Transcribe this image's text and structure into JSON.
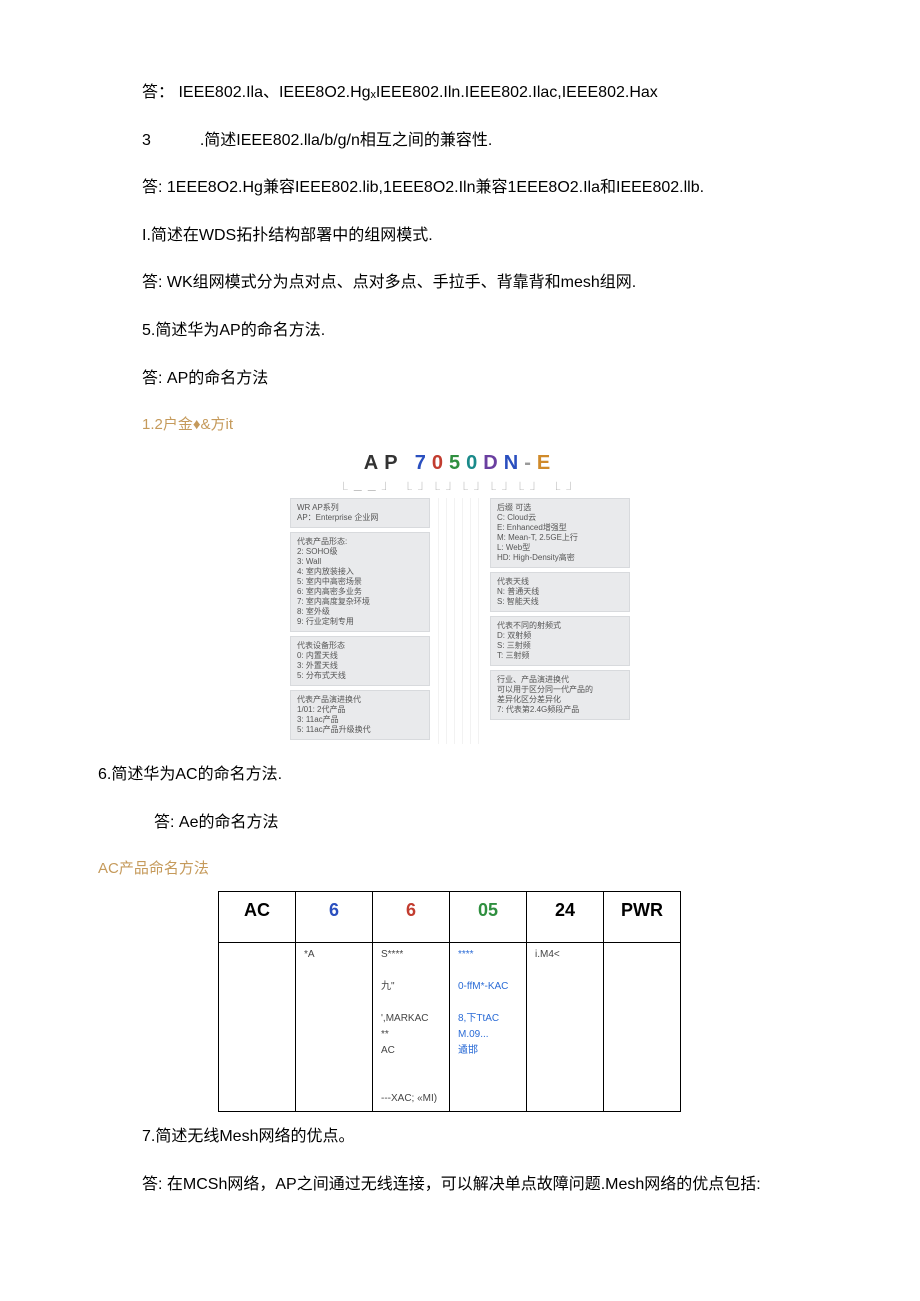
{
  "intro": {
    "answer_prefix": "答：",
    "standards": "IEEE802.Ila、IEEE8O2.HgₓIEEE802.Iln.IEEE802.Ilac,IEEE802.Hax"
  },
  "q3": {
    "number": "3",
    "text": ".简述IEEE802.lla/b/g/n相互之间的兼容性.",
    "answer": "答: 1EEE8O2.Hg兼容IEEE802.lib,1EEE8O2.Iln兼容1EEE8O2.Ila和IEEE802.llb."
  },
  "q4": {
    "text": "I.简述在WDS拓扑结构部署中的组网模式.",
    "answer": "答: WK组网模式分为点对点、点对多点、手拉手、背靠背和mesh组网."
  },
  "q5": {
    "text": "5.简述华为AP的命名方法.",
    "answer": "答: AP的命名方法",
    "sub_heading": "1.2户金♦&方it"
  },
  "ap_diagram": {
    "title_parts": [
      "A",
      "P",
      " ",
      "7",
      "0",
      "5",
      "0",
      "D",
      "N",
      "-",
      "E"
    ],
    "under": "⎿⎽⎽⏌ ⎿⏌⎿⏌⎿⏌⎿⏌⎿⏌  ⎿⏌",
    "left_boxes": [
      "WR AP系列\nAP：Enterprise 企业网",
      "代表产品形态:\n2: SOHO级\n3: Wall\n4: 室内放装接入\n5: 室内中高密场景\n6: 室内高密多业务\n7: 室内高度复杂环境\n8: 室外级\n9: 行业定制专用",
      "代表设备形态\n0: 内置天线\n3: 外置天线\n5: 分布式天线",
      "代表产品演进换代\n1/01: 2代产品\n3: 11ac产品\n5: 11ac产品升级换代"
    ],
    "right_boxes": [
      "后缀 可选\nC: Cloud云\nE: Enhanced增强型\nM: Mean-T, 2.5GE上行\nL: Web型\nHD: High-Density高密",
      "代表天线\nN: 普通天线\nS: 智能天线",
      "代表不同的射频式\nD: 双射频\nS: 三射频\nT: 三射频",
      "行业、产品演进换代\n可以用于区分同一代产品的\n差异化区分差异化\n7: 代表第2.4G频段产品"
    ]
  },
  "q6": {
    "text": "6.简述华为AC的命名方法.",
    "answer": "答: Ae的命名方法",
    "sub_heading": "AC产品命名方法"
  },
  "ac_table": {
    "headers": [
      "AC",
      "6",
      "6",
      "05",
      "24",
      "PWR"
    ],
    "row_cells": [
      "",
      "*A",
      "S****\n\n九\"\n\n',MARKAC\n**\nAC\n\n\n---XAC; «MI)",
      "****\n\n0-ffM*-KAC\n\n8,下TtAC\nM.09...\n遹邯",
      "i.M4<",
      ""
    ]
  },
  "q7": {
    "text": "7.简述无线Mesh网络的优点。",
    "answer": "答: 在MCSh网络，AP之间通过无线连接，可以解决单点故障问题.Mesh网络的优点包括:"
  }
}
